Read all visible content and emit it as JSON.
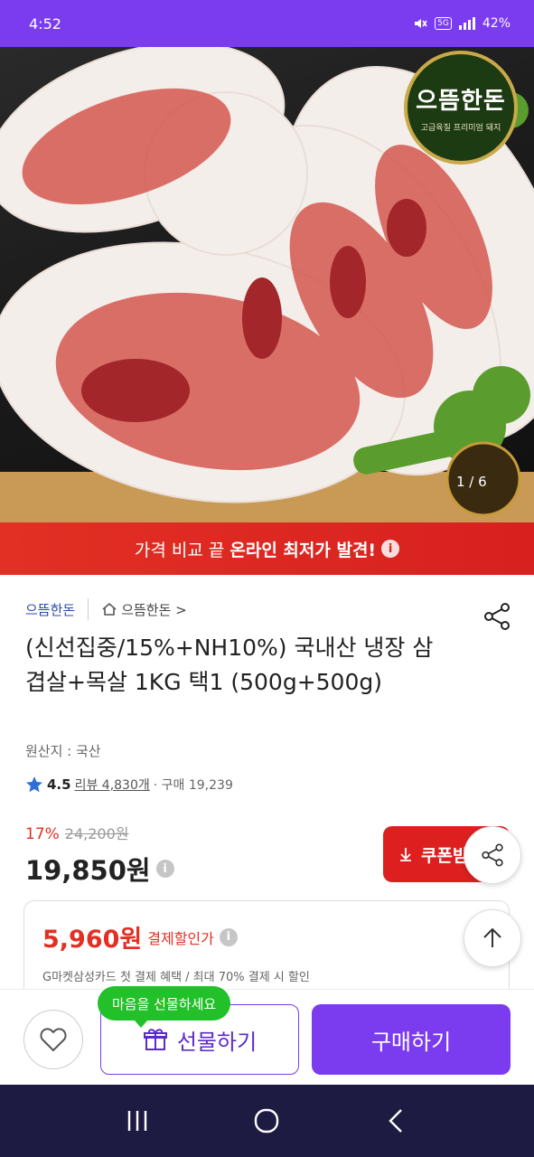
{
  "status_bar": {
    "time": "4:52",
    "network": "5G",
    "battery": "42%"
  },
  "hero": {
    "brand_badge_name": "으뜸한돈",
    "brand_badge_sub": "고급육질 프리미엄 돼지",
    "page_indicator": "1 / 6"
  },
  "promo": {
    "prefix": "가격 비교 끝 ",
    "highlight": "온라인 최저가 발견!"
  },
  "seller": {
    "name": "으뜸한돈",
    "store_link": "으뜸한돈 >"
  },
  "product": {
    "title": "(신선집중/15%+NH10%) 국내산 냉장 삼겹살+목살 1KG 택1 (500g+500g)",
    "origin": "원산지 : 국산",
    "rating": "4.5",
    "review_label": "리뷰 4,830개",
    "purchase_label": "· 구매 19,239",
    "discount_rate": "17%",
    "original_price": "24,200원",
    "price": "19,850원"
  },
  "coupon": {
    "label": "쿠폰받기"
  },
  "payment": {
    "amount": "5,960원",
    "label": "결제할인가",
    "desc": "G마켓삼성카드 첫 결제 혜택 / 최대 70% 결제 시 할인"
  },
  "actions": {
    "gift_tooltip": "마음을 선물하세요",
    "gift_label": "선물하기",
    "buy_label": "구매하기"
  },
  "colors": {
    "accent": "#7b3cf0",
    "promo_red": "#e23024",
    "tooltip_green": "#22c12a"
  }
}
